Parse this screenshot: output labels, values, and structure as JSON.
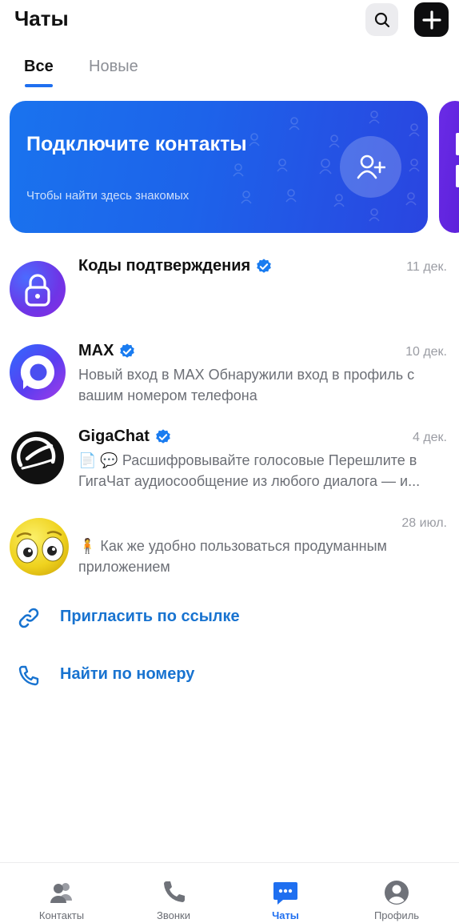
{
  "header": {
    "title": "Чаты",
    "search_icon": "search-icon",
    "new_icon": "plus-icon"
  },
  "tabs": [
    {
      "label": "Все",
      "active": true
    },
    {
      "label": "Новые",
      "active": false
    }
  ],
  "banner": {
    "title": "Подключите контакты",
    "subtitle": "Чтобы найти здесь знакомых",
    "icon": "add-user-icon",
    "color_start": "#1a73ee",
    "color_end": "#2a45e0"
  },
  "chats": [
    {
      "name": "Коды подтверждения",
      "date": "11 дек.",
      "message": "",
      "verified": true,
      "avatar": "lock-avatar"
    },
    {
      "name": "MAX",
      "date": "10 дек.",
      "message": "Новый вход в MAX Обнаружили вход в профиль с вашим номером телефона",
      "verified": true,
      "avatar": "max-logo"
    },
    {
      "name": "GigaChat",
      "date": "4 дек.",
      "message": "📄 💬 Расшифровывайте голосовые Перешлите в ГигаЧат аудиосообщение из любого диалога — и...",
      "verified": true,
      "avatar": "gigachat-logo"
    },
    {
      "name": "",
      "date": "28 июл.",
      "message": "🧍 Как же удобно пользоваться продуманным приложением",
      "verified": false,
      "avatar": "emoji-face"
    }
  ],
  "actions": [
    {
      "label": "Пригласить по ссылке",
      "icon": "link-icon"
    },
    {
      "label": "Найти по номеру",
      "icon": "phone-icon"
    }
  ],
  "tabbar": [
    {
      "label": "Контакты",
      "icon": "contacts-icon",
      "active": false
    },
    {
      "label": "Звонки",
      "icon": "phone-icon",
      "active": false
    },
    {
      "label": "Чаты",
      "icon": "chats-icon",
      "active": true
    },
    {
      "label": "Профиль",
      "icon": "profile-icon",
      "active": false
    }
  ],
  "colors": {
    "accent": "#1f6ff0",
    "link": "#1873d0",
    "verified": "#1a7cf0"
  }
}
